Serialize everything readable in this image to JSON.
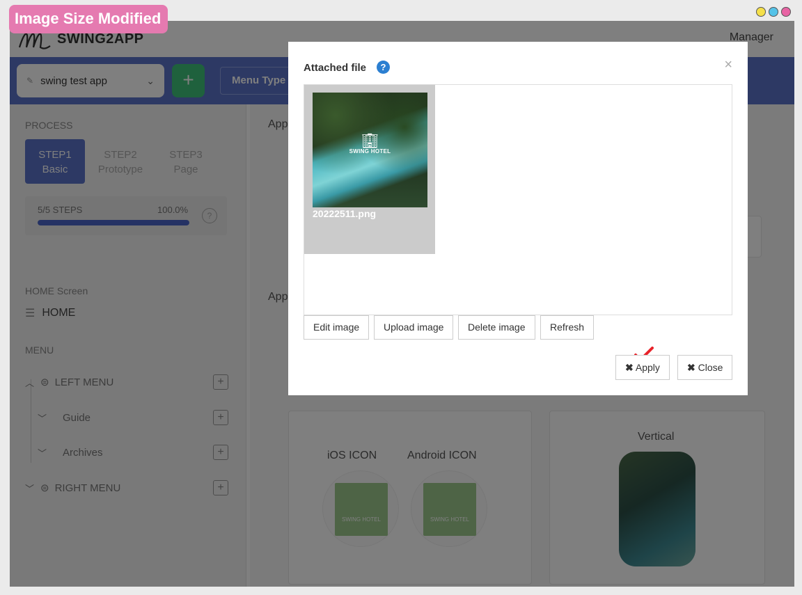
{
  "badge": "Image Size Modified",
  "window_dots": [
    "#f5e04a",
    "#55c3e8",
    "#e864a4"
  ],
  "app": {
    "brand": "SWING2APP",
    "manager": "Manager",
    "app_select": "swing test app",
    "add_label": "+",
    "menu_type": "Menu Type"
  },
  "sidebar": {
    "process_label": "PROCESS",
    "steps": [
      {
        "line1": "STEP1",
        "line2": "Basic"
      },
      {
        "line1": "STEP2",
        "line2": "Prototype"
      },
      {
        "line1": "STEP3",
        "line2": "Page"
      }
    ],
    "progress_label": "5/5 STEPS",
    "progress_value": "100.0%",
    "progress_fraction": 1.0,
    "home_label": "HOME Screen",
    "home_item": "HOME",
    "menu_label": "MENU",
    "menu_items": [
      "LEFT MENU",
      "Guide",
      "Archives",
      "RIGHT MENU"
    ]
  },
  "content": {
    "app_partial_1": "App",
    "app_partial_2": "App",
    "ios_icon": "iOS ICON",
    "android_icon": "Android ICON",
    "vertical": "Vertical",
    "hotel_name": "SWING HOTEL"
  },
  "modal": {
    "title": "Attached file",
    "help": "?",
    "close_x": "×",
    "file_name": "20222511.png",
    "thumb_logo_text": "SWING HOTEL",
    "buttons": {
      "edit": "Edit image",
      "upload": "Upload image",
      "delete": "Delete image",
      "refresh": "Refresh"
    },
    "apply": "Apply",
    "close": "Close"
  }
}
